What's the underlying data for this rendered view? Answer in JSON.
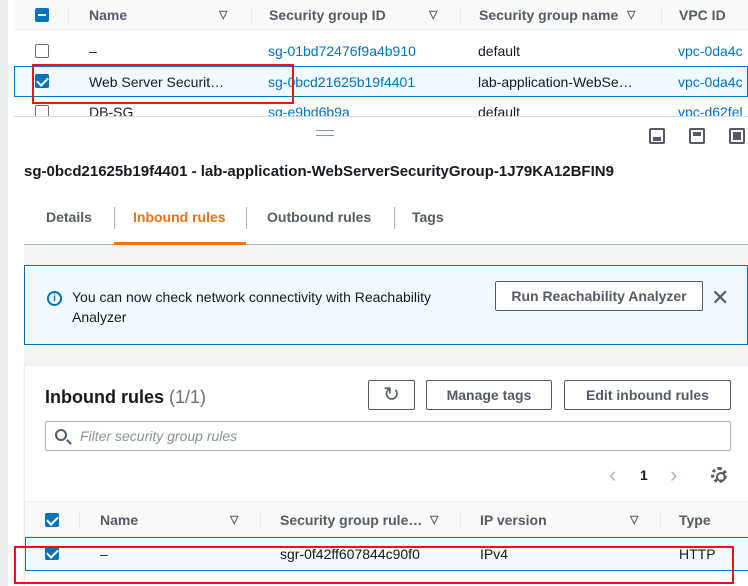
{
  "top_table": {
    "headers": {
      "name": "Name",
      "sg_id": "Security group ID",
      "sg_name": "Security group name",
      "vpc_id": "VPC ID"
    },
    "rows": [
      {
        "name": "–",
        "sg_id": "sg-01bd72476f9a4b910",
        "sg_name": "default",
        "vpc_id": "vpc-0da4c",
        "selected": false
      },
      {
        "name": "Web Server Securit…",
        "sg_id": "sg-0bcd21625b19f4401",
        "sg_name": "lab-application-WebSe…",
        "vpc_id": "vpc-0da4c",
        "selected": true
      },
      {
        "name": "DB-SG",
        "sg_id": "sg-e9bd6b9a",
        "sg_name": "default",
        "vpc_id": "vpc-d62fel",
        "selected": false
      }
    ]
  },
  "details": {
    "title": "sg-0bcd21625b19f4401 - lab-application-WebServerSecurityGroup-1J79KA12BFIN9",
    "tabs": [
      "Details",
      "Inbound rules",
      "Outbound rules",
      "Tags"
    ],
    "active_tab": "Inbound rules"
  },
  "info_alert": {
    "message": "You can now check network connectivity with Reachability Analyzer",
    "button_label": "Run Reachability Analyzer",
    "close_symbol": "✕"
  },
  "inbound": {
    "title": "Inbound rules",
    "count": "(1/1)",
    "refresh_symbol": "↻",
    "manage_tags_label": "Manage tags",
    "edit_label": "Edit inbound rules",
    "search_placeholder": "Filter security group rules",
    "page": "1",
    "prev_symbol": "‹",
    "next_symbol": "›",
    "headers": {
      "name": "Name",
      "rule_id": "Security group rule…",
      "ip_version": "IP version",
      "type": "Type"
    },
    "rows": [
      {
        "name": "–",
        "rule_id": "sgr-0f42ff607844c90f0",
        "ip_version": "IPv4",
        "type": "HTTP",
        "selected": true
      }
    ]
  },
  "sort_caret": "▽",
  "colors": {
    "link": "#0073bb",
    "active_tab": "#ec7211",
    "highlight_box": "#e8141b"
  }
}
